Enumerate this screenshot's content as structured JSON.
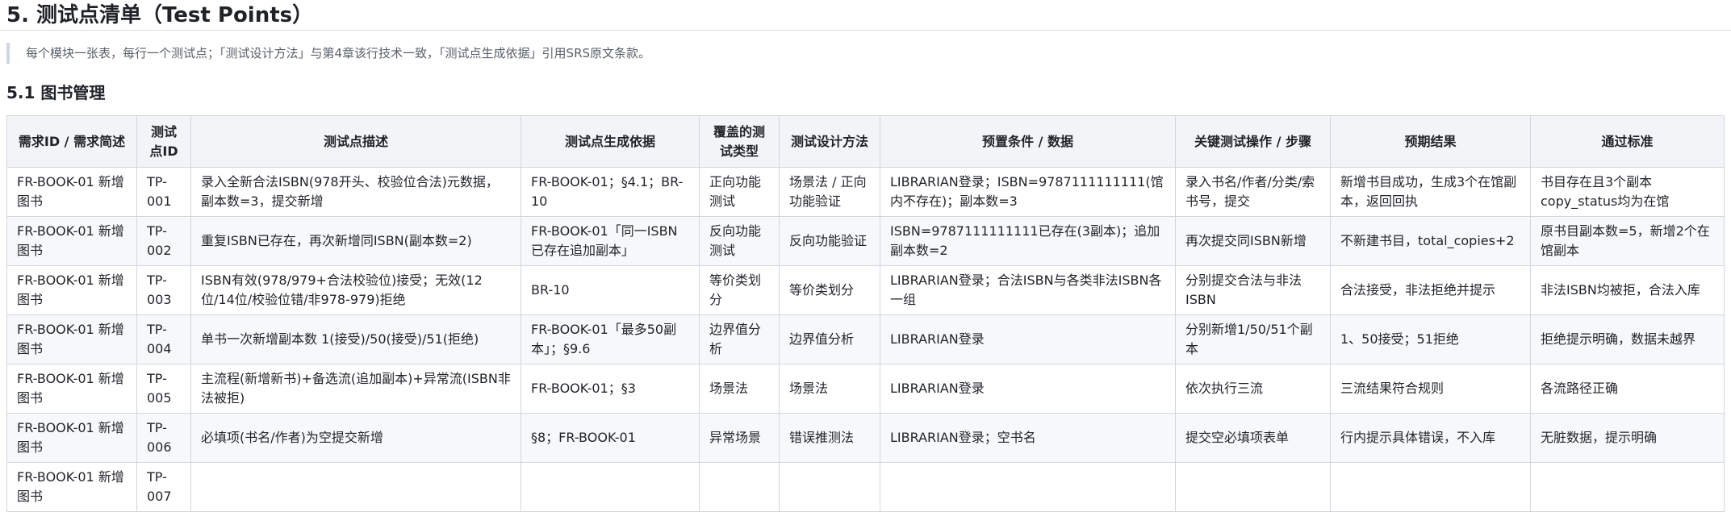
{
  "section": {
    "title": "5. 测试点清单（Test Points）",
    "note": "每个模块一张表，每行一个测试点；「测试设计方法」与第4章该行技术一致，「测试点生成依据」引用SRS原文条款。"
  },
  "subsection": {
    "title": "5.1 图书管理"
  },
  "table": {
    "headers": [
      "需求ID / 需求简述",
      "测试点ID",
      "测试点描述",
      "测试点生成依据",
      "覆盖的测试类型",
      "测试设计方法",
      "预置条件 / 数据",
      "关键测试操作 / 步骤",
      "预期结果",
      "通过标准"
    ],
    "rows": [
      [
        "FR-BOOK-01 新增图书",
        "TP-001",
        "录入全新合法ISBN(978开头、校验位合法)元数据，副本数=3，提交新增",
        "FR-BOOK-01；§4.1；BR-10",
        "正向功能测试",
        "场景法 / 正向功能验证",
        "LIBRARIAN登录；ISBN=9787111111111(馆内不存在)；副本数=3",
        "录入书名/作者/分类/索书号，提交",
        "新增书目成功，生成3个在馆副本，返回回执",
        "书目存在且3个副本copy_status均为在馆"
      ],
      [
        "FR-BOOK-01 新增图书",
        "TP-002",
        "重复ISBN已存在，再次新增同ISBN(副本数=2)",
        "FR-BOOK-01「同一ISBN已存在追加副本」",
        "反向功能测试",
        "反向功能验证",
        "ISBN=9787111111111已存在(3副本)；追加副本数=2",
        "再次提交同ISBN新增",
        "不新建书目，total_copies+2",
        "原书目副本数=5，新增2个在馆副本"
      ],
      [
        "FR-BOOK-01 新增图书",
        "TP-003",
        "ISBN有效(978/979+合法校验位)接受；无效(12位/14位/校验位错/非978-979)拒绝",
        "BR-10",
        "等价类划分",
        "等价类划分",
        "LIBRARIAN登录；合法ISBN与各类非法ISBN各一组",
        "分别提交合法与非法ISBN",
        "合法接受，非法拒绝并提示",
        "非法ISBN均被拒，合法入库"
      ],
      [
        "FR-BOOK-01 新增图书",
        "TP-004",
        "单书一次新增副本数 1(接受)/50(接受)/51(拒绝)",
        "FR-BOOK-01「最多50副本」；§9.6",
        "边界值分析",
        "边界值分析",
        "LIBRARIAN登录",
        "分别新增1/50/51个副本",
        "1、50接受；51拒绝",
        "拒绝提示明确，数据未越界"
      ],
      [
        "FR-BOOK-01 新增图书",
        "TP-005",
        "主流程(新增新书)+备选流(追加副本)+异常流(ISBN非法被拒)",
        "FR-BOOK-01；§3",
        "场景法",
        "场景法",
        "LIBRARIAN登录",
        "依次执行三流",
        "三流结果符合规则",
        "各流路径正确"
      ],
      [
        "FR-BOOK-01 新增图书",
        "TP-006",
        "必填项(书名/作者)为空提交新增",
        "§8；FR-BOOK-01",
        "异常场景",
        "错误推测法",
        "LIBRARIAN登录；空书名",
        "提交空必填项表单",
        "行内提示具体错误，不入库",
        "无脏数据，提示明确"
      ],
      [
        "FR-BOOK-01 新增图书",
        "TP-007",
        "",
        "",
        "",
        "",
        "",
        "",
        "",
        ""
      ]
    ]
  }
}
